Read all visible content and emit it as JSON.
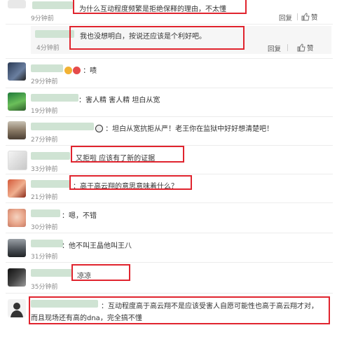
{
  "actions": {
    "reply": "回复",
    "like": "赞"
  },
  "comments": [
    {
      "text": "为什么互动程度频繁是拒绝保释的理由，不太懂",
      "time": "9分钟前"
    },
    {
      "text": "我也没想明白，按说还应该是个利好吧。",
      "time": "4分钟前"
    },
    {
      "text": "：啧",
      "time": "29分钟前"
    },
    {
      "text": "：害人精 害人精 坦白从宽",
      "time": "19分钟前"
    },
    {
      "text": "：坦白从宽抗拒从严！老王你在监狱中好好想清楚吧！",
      "time": "27分钟前"
    },
    {
      "text": "又拒啦 应该有了新的证据",
      "time": "33分钟前"
    },
    {
      "text": "：高于高云翔的意思意味着什么？",
      "time": "21分钟前"
    },
    {
      "text": "：嗯，不错",
      "time": "30分钟前"
    },
    {
      "text": "：他不叫王晶他叫王八",
      "time": "31分钟前"
    },
    {
      "text": "凉凉",
      "time": "35分钟前"
    },
    {
      "text": "：互动程度高于高云翔不是应该受害人自愿可能性也高于高云翔才对，",
      "text2": "而且现场还有高的dna，完全搞不懂"
    }
  ]
}
